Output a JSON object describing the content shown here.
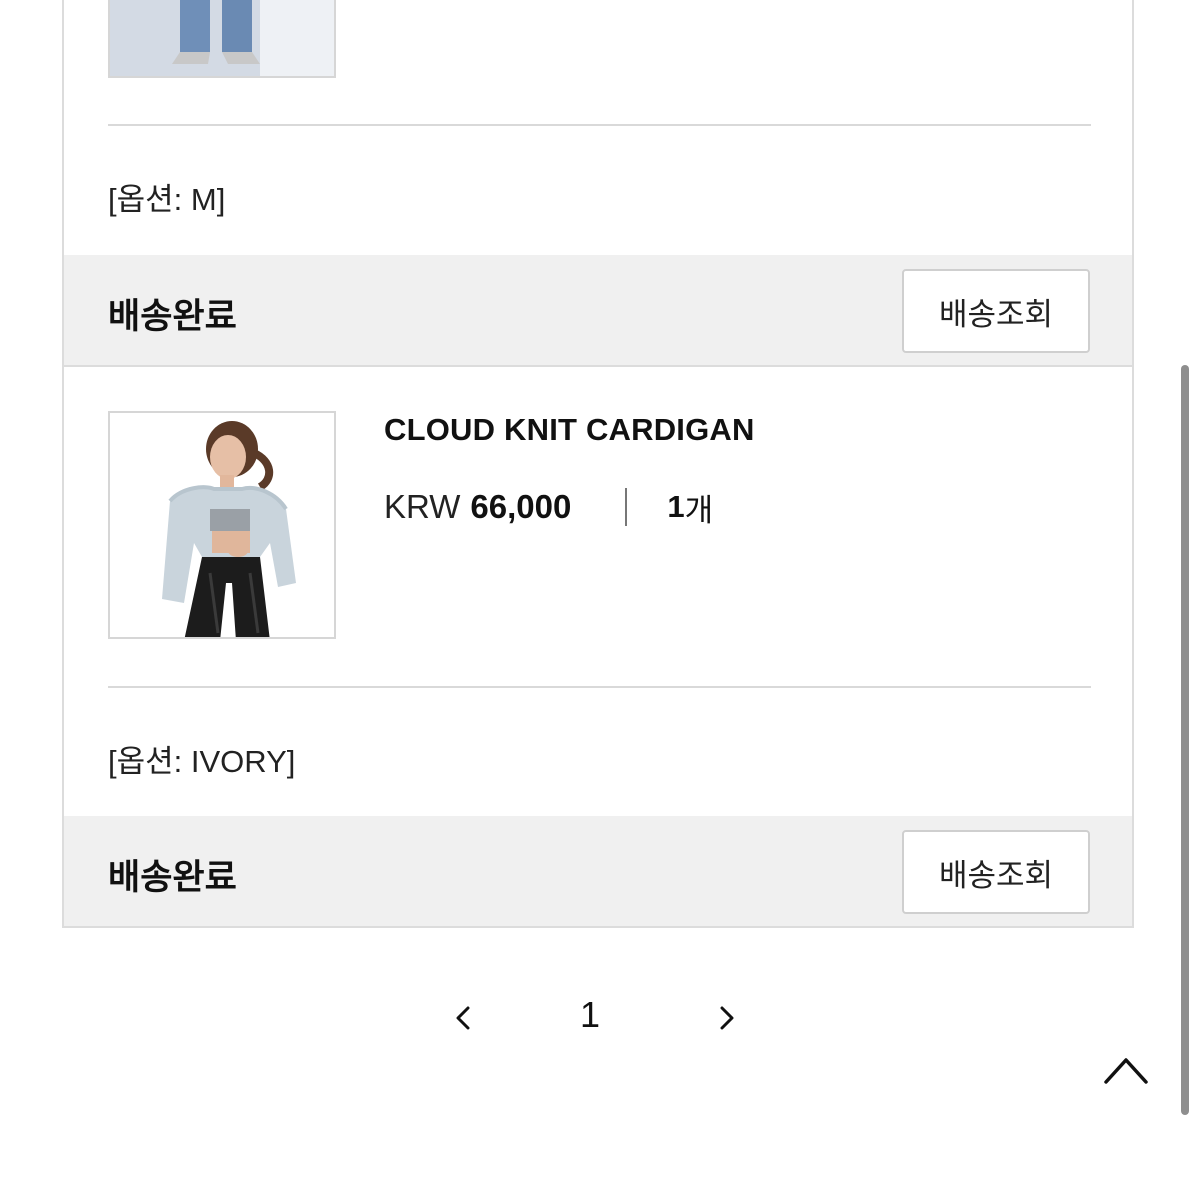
{
  "order": {
    "items": [
      {
        "option_text": "[옵션: M]",
        "status": "배송완료",
        "track_button": "배송조회"
      },
      {
        "product_name": "CLOUD KNIT CARDIGAN",
        "currency": "KRW",
        "price": "66,000",
        "quantity": "1",
        "quantity_unit": "개",
        "option_text": "[옵션: IVORY]",
        "status": "배송완료",
        "track_button": "배송조회"
      }
    ]
  },
  "pagination": {
    "current_page": "1",
    "prev_icon": "chevron-left-icon",
    "next_icon": "chevron-right-icon"
  },
  "scroll_top": {
    "icon": "chevron-up-icon"
  },
  "colors": {
    "status_bar_bg": "#f0f0f0",
    "border": "#dcdcdc",
    "text": "#111111"
  }
}
